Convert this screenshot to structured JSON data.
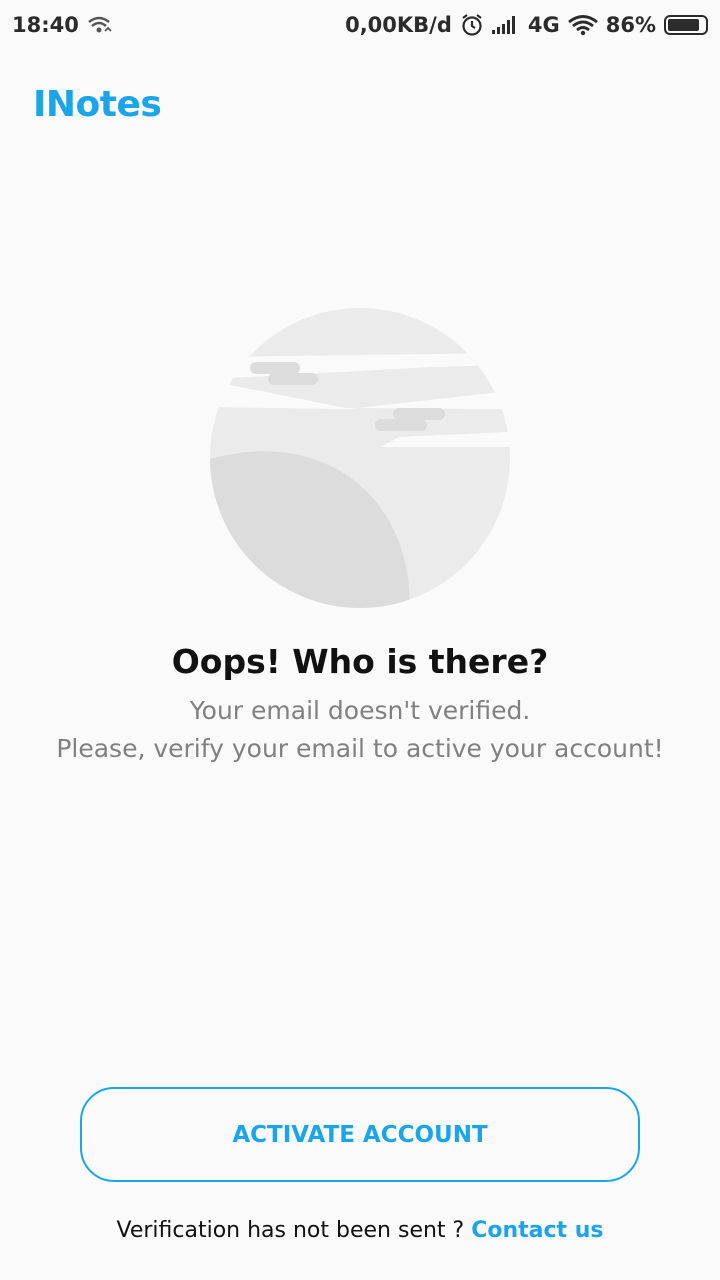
{
  "status_bar": {
    "time": "18:40",
    "network_speed": "0,00KB/d",
    "network_type": "4G",
    "battery_percent": "86%",
    "battery_level": 0.86,
    "icons": [
      "wifi-call-icon",
      "alarm-icon",
      "signal-icon",
      "wifi-icon",
      "battery-icon"
    ]
  },
  "app": {
    "title": "INotes"
  },
  "main": {
    "illustration_icon": "moon-clouds-illustration-icon",
    "headline": "Oops! Who is there?",
    "message_line1": "Your email doesn't verified.",
    "message_line2": "Please, verify your email to active your account!"
  },
  "actions": {
    "activate_label": "ACTIVATE ACCOUNT"
  },
  "footer": {
    "prompt": "Verification has not been sent ? ",
    "contact_label": "Contact us"
  },
  "colors": {
    "accent": "#1aa5e8",
    "background": "#fafafa",
    "illustration_light": "#ebebeb",
    "illustration_dark": "#dcdcdc"
  }
}
